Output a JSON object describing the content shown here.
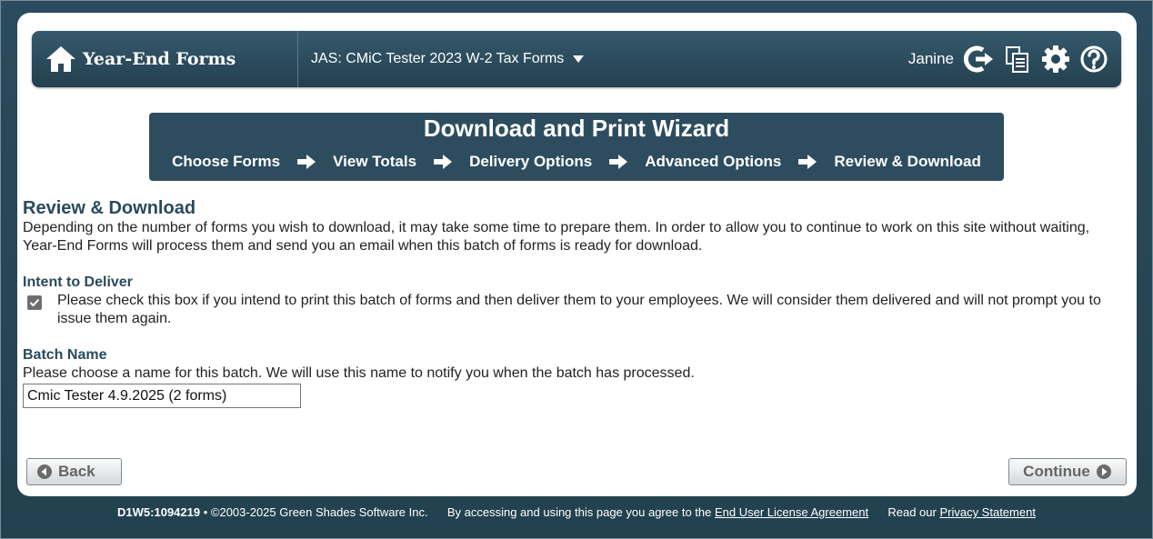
{
  "app": {
    "brand": "Year-End Forms",
    "project": "JAS: CMiC Tester 2023 W-2 Tax Forms",
    "user": "Janine"
  },
  "wizard": {
    "title": "Download and Print Wizard",
    "steps": [
      "Choose Forms",
      "View Totals",
      "Delivery Options",
      "Advanced Options",
      "Review & Download"
    ]
  },
  "review": {
    "title": "Review & Download",
    "description": "Depending on the number of forms you wish to download, it may take some time to prepare them. In order to allow you to continue to work on this site without waiting, Year-End Forms will process them and send you an email when this batch of forms is ready for download."
  },
  "intent": {
    "title": "Intent to Deliver",
    "checked": true,
    "text": "Please check this box if you intend to print this batch of forms and then deliver them to your employees. We will consider them delivered and will not prompt you to issue them again."
  },
  "batch": {
    "title": "Batch Name",
    "help": "Please choose a name for this batch. We will use this name to notify you when the batch has processed.",
    "value": "Cmic Tester 4.9.2025 (2 forms)"
  },
  "buttons": {
    "back": "Back",
    "continue": "Continue"
  },
  "footer": {
    "build": "D1W5:1094219",
    "copyright": "• ©2003-2025 Green Shades Software Inc.",
    "agree_prefix": "By accessing and using this page you agree to the",
    "eula_link": "End User License Agreement",
    "privacy_prefix": "Read our",
    "privacy_link": "Privacy Statement"
  },
  "colors": {
    "header_bg": "#2d4d5f",
    "heading": "#2a4a5c",
    "page_bg": "#2a4a5c"
  }
}
